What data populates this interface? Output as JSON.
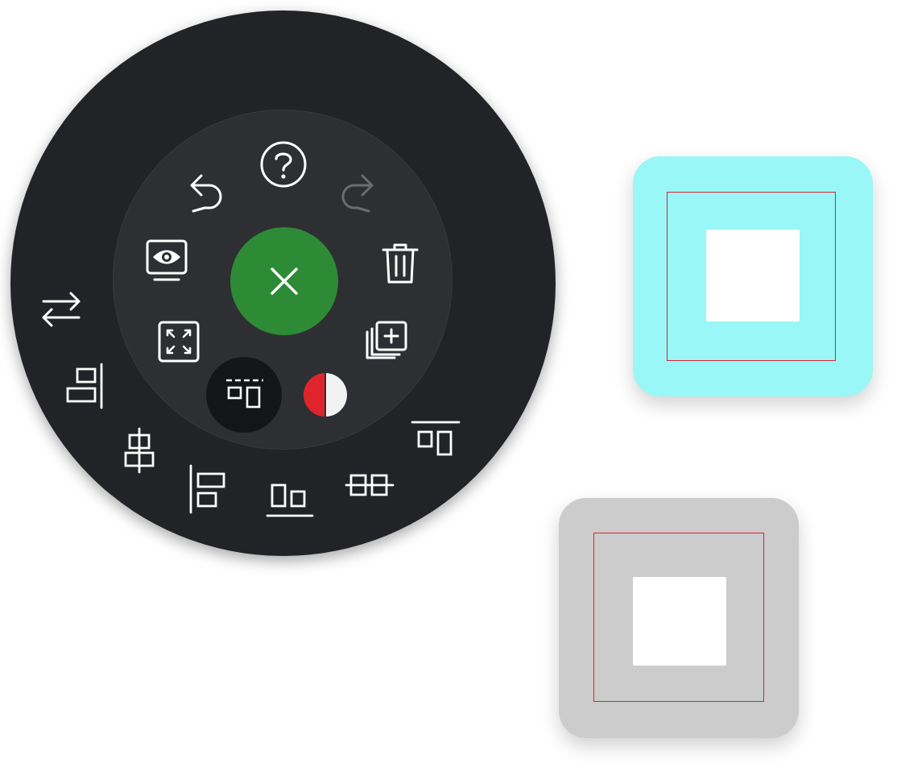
{
  "radial_menu": {
    "center_action": "close",
    "inner_actions": [
      "help",
      "undo",
      "redo",
      "display",
      "delete",
      "fit-to-screen",
      "add-layer",
      "align-top",
      "color"
    ],
    "outer_actions": [
      "swap",
      "align-right",
      "align-center-horizontal",
      "align-left",
      "align-bottom",
      "align-center-vertical",
      "align-top"
    ],
    "active_action": "align-top",
    "colors": {
      "outer_ring": "#222326",
      "inner_ring": "#2d2f32",
      "center_button": "#2e8b35",
      "icon": "#ffffff",
      "icon_disabled": "#6a6c6f",
      "color_swatch_left": "#e0242c",
      "color_swatch_right": "#f2f2f2"
    }
  },
  "canvas": {
    "shapes": [
      {
        "fill": "#99f7f7",
        "selection_color": "#d9232e"
      },
      {
        "fill": "#cccccc",
        "selection_color": "#d9232e"
      }
    ]
  }
}
